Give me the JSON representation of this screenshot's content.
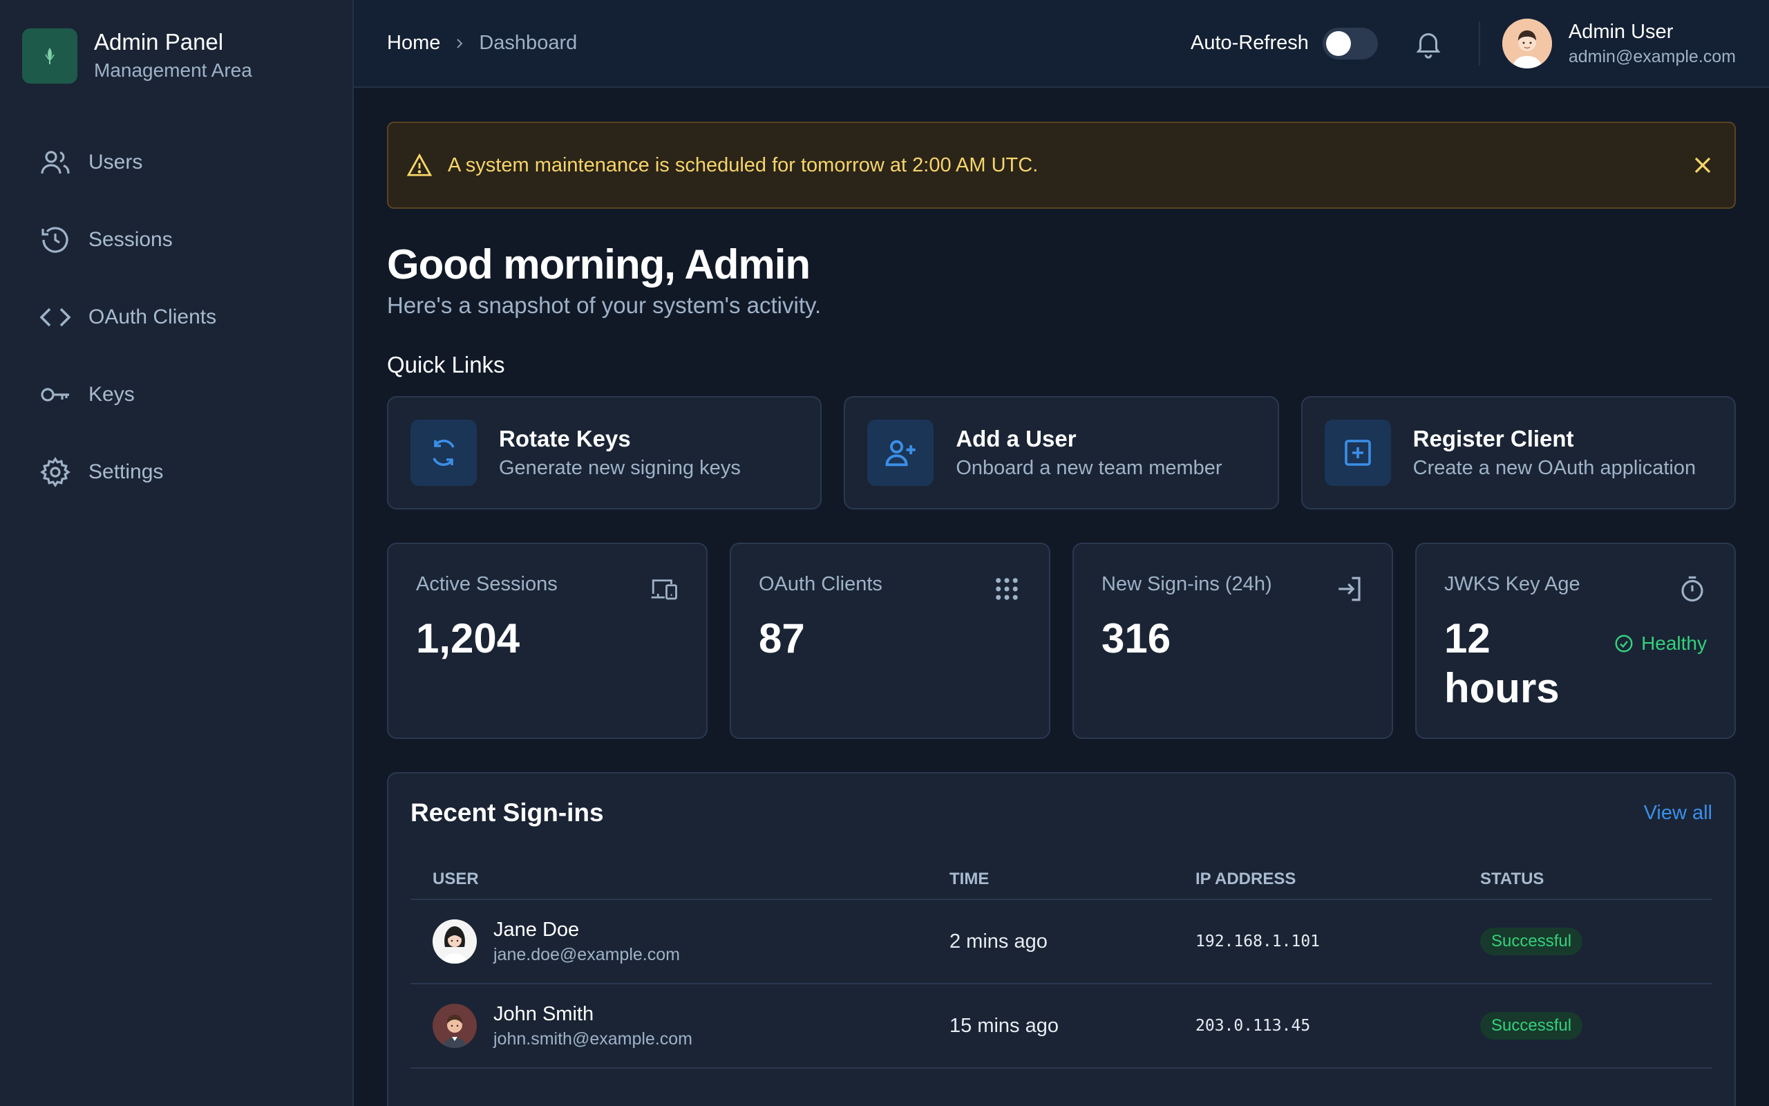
{
  "brand": {
    "title": "Admin Panel",
    "subtitle": "Management Area"
  },
  "sidebar": {
    "items": [
      {
        "label": "Users",
        "icon": "users-icon"
      },
      {
        "label": "Sessions",
        "icon": "history-icon"
      },
      {
        "label": "OAuth Clients",
        "icon": "code-icon"
      },
      {
        "label": "Keys",
        "icon": "key-icon"
      },
      {
        "label": "Settings",
        "icon": "gear-icon"
      }
    ]
  },
  "header": {
    "breadcrumb": {
      "home": "Home",
      "current": "Dashboard"
    },
    "auto_refresh_label": "Auto-Refresh",
    "auto_refresh_on": false,
    "user": {
      "name": "Admin User",
      "email": "admin@example.com"
    }
  },
  "alert": {
    "text": "A system maintenance is scheduled for tomorrow at 2:00 AM UTC.",
    "color": "#f6d56a"
  },
  "greeting": {
    "title": "Good morning, Admin",
    "subtitle": "Here's a snapshot of your system's activity."
  },
  "quick_links": {
    "label": "Quick Links",
    "items": [
      {
        "title": "Rotate Keys",
        "description": "Generate new signing keys",
        "icon": "refresh-icon"
      },
      {
        "title": "Add a User",
        "description": "Onboard a new team member",
        "icon": "user-plus-icon"
      },
      {
        "title": "Register Client",
        "description": "Create a new OAuth application",
        "icon": "plus-square-icon"
      }
    ]
  },
  "stats": [
    {
      "label": "Active Sessions",
      "value": "1,204",
      "icon": "devices-icon"
    },
    {
      "label": "OAuth Clients",
      "value": "87",
      "icon": "grid-dots-icon"
    },
    {
      "label": "New Sign-ins (24h)",
      "value": "316",
      "icon": "sign-in-icon"
    },
    {
      "label": "JWKS Key Age",
      "value": "12 hours",
      "icon": "stopwatch-icon",
      "status": "Healthy"
    }
  ],
  "recent": {
    "title": "Recent Sign-ins",
    "view_all": "View all",
    "columns": [
      "USER",
      "TIME",
      "IP ADDRESS",
      "STATUS"
    ],
    "rows": [
      {
        "name": "Jane Doe",
        "email": "jane.doe@example.com",
        "time": "2 mins ago",
        "ip": "192.168.1.101",
        "status": "Successful"
      },
      {
        "name": "John Smith",
        "email": "john.smith@example.com",
        "time": "15 mins ago",
        "ip": "203.0.113.45",
        "status": "Successful"
      }
    ]
  },
  "colors": {
    "accent": "#3b8fe8",
    "success": "#34d17b",
    "warning": "#f6d56a"
  }
}
